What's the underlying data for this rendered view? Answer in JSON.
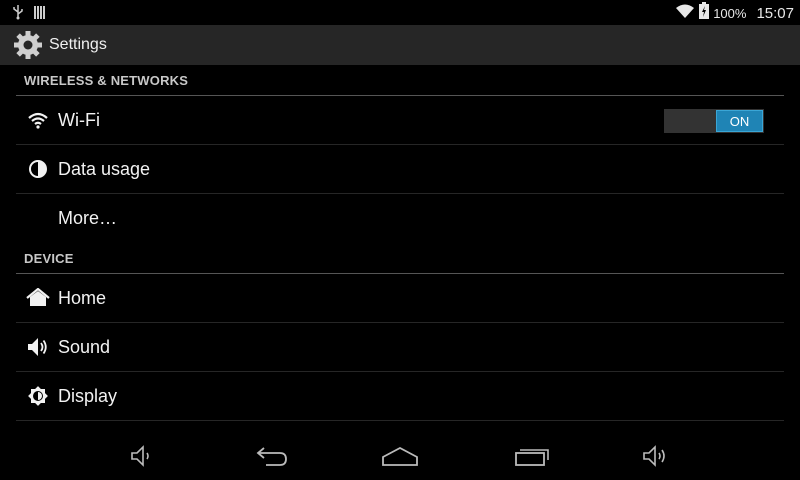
{
  "status_bar": {
    "battery_text": "100%",
    "time": "15:07",
    "icons": [
      "usb-icon",
      "sd-card-icon",
      "wifi-signal-icon",
      "battery-charging-icon"
    ]
  },
  "action_bar": {
    "title": "Settings",
    "icon": "settings-gear-icon"
  },
  "sections": {
    "wireless": {
      "header": "WIRELESS & NETWORKS",
      "wifi": {
        "label": "Wi-Fi",
        "toggle": "ON"
      },
      "data_usage": {
        "label": "Data usage"
      },
      "more": {
        "label": "More…"
      }
    },
    "device": {
      "header": "DEVICE",
      "home": {
        "label": "Home"
      },
      "sound": {
        "label": "Sound"
      },
      "display": {
        "label": "Display"
      }
    }
  },
  "colors": {
    "accent": "#1f84b5",
    "action_bar": "#262626",
    "background": "#000000",
    "divider": "#555555"
  },
  "nav_bar": {
    "buttons": [
      "volume-down-icon",
      "back-icon",
      "home-icon",
      "recent-apps-icon",
      "volume-up-icon"
    ]
  }
}
